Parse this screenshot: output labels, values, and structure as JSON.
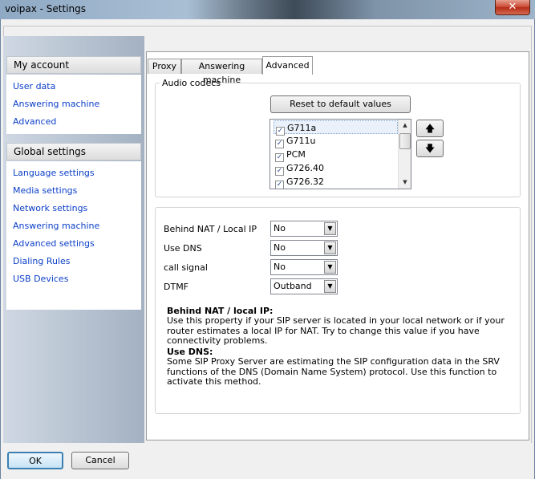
{
  "window": {
    "title": "voipax - Settings",
    "close_glyph": "✕"
  },
  "sidebar": {
    "my_account": {
      "heading": "My account",
      "items": [
        "User data",
        "Answering machine",
        "Advanced"
      ]
    },
    "global_settings": {
      "heading": "Global settings",
      "items": [
        "Language settings",
        "Media settings",
        "Network settings",
        "Answering machine",
        "Advanced settings",
        "Dialing Rules",
        "USB Devices"
      ]
    }
  },
  "tabs": [
    "Proxy",
    "Answering machine",
    "Advanced"
  ],
  "active_tab": "Advanced",
  "audio_codecs": {
    "legend": "Audio codecs",
    "reset_label": "Reset to default values",
    "codecs": [
      {
        "name": "G711a",
        "checked": true,
        "selected": true
      },
      {
        "name": "G711u",
        "checked": true
      },
      {
        "name": "PCM",
        "checked": true
      },
      {
        "name": "G726.40",
        "checked": true
      },
      {
        "name": "G726.32",
        "checked": true
      }
    ],
    "up_glyph": "🡅",
    "down_glyph": "🡇"
  },
  "settings": [
    {
      "label": "Behind NAT / Local IP",
      "value": "No"
    },
    {
      "label": "Use DNS",
      "value": "No"
    },
    {
      "label": "call signal",
      "value": "No"
    },
    {
      "label": "DTMF",
      "value": "Outband"
    }
  ],
  "help": {
    "nat_title": "Behind NAT / local IP:",
    "nat_text": "Use this property if your SIP server is located in your local network or if your router estimates a local IP for NAT. Try to change this value if you have connectivity problems.",
    "dns_title": "Use DNS:",
    "dns_text": "Some SIP Proxy Server are estimating the SIP configuration data in the SRV functions of the DNS (Domain Name System) protocol. Use this function to activate this method."
  },
  "buttons": {
    "ok": "OK",
    "cancel": "Cancel"
  },
  "colors": {
    "link": "#0b3fc8",
    "close_button": "#c84630"
  }
}
